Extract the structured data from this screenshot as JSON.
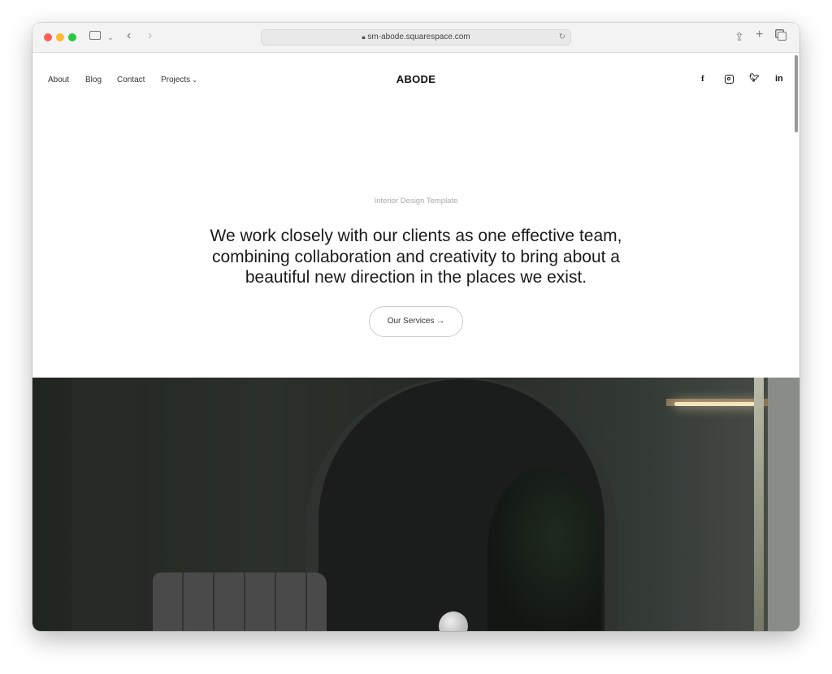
{
  "browser": {
    "url": "sm-abode.squarespace.com",
    "colors": {
      "close": "#fe5f57",
      "minimize": "#febc2e",
      "maximize": "#28c840"
    }
  },
  "nav": {
    "items": [
      "About",
      "Blog",
      "Contact",
      "Projects"
    ],
    "logo": "ABODE",
    "social": [
      "facebook",
      "instagram",
      "twitter",
      "linkedin"
    ]
  },
  "hero": {
    "eyebrow": "Interior Design Template",
    "headline": "We work closely with our clients as one effective team, combining collaboration and creativity to bring about a beautiful new direction in the places we exist.",
    "cta": "Our Services →"
  }
}
